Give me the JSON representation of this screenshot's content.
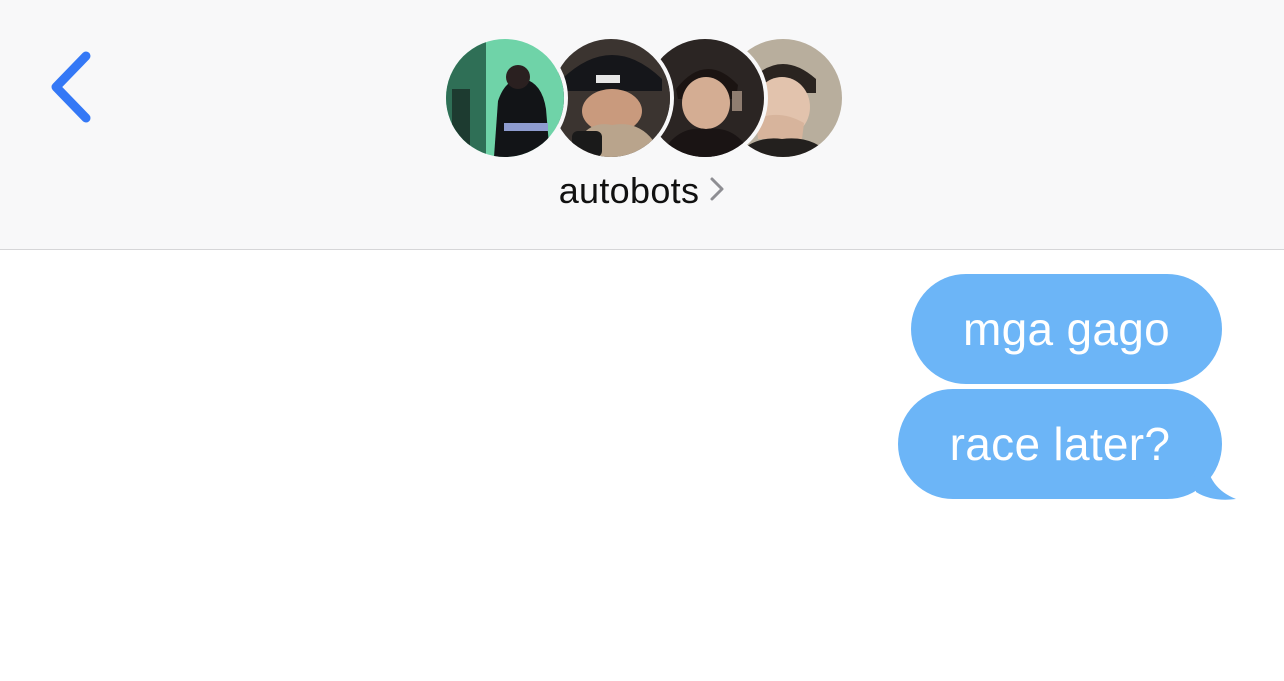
{
  "header": {
    "group_name": "autobots",
    "back_icon": "chevron-left-icon",
    "detail_icon": "chevron-right-icon",
    "avatars": [
      {
        "name": "avatar-member-1",
        "bg": "#6fd3a8"
      },
      {
        "name": "avatar-member-2",
        "bg": "#3b3430"
      },
      {
        "name": "avatar-member-3",
        "bg": "#2b2523"
      },
      {
        "name": "avatar-member-4",
        "bg": "#5e5246"
      }
    ]
  },
  "messages": [
    {
      "text": "mga gago",
      "sender": "me"
    },
    {
      "text": "race later?",
      "sender": "me"
    }
  ],
  "colors": {
    "accent": "#3478f6",
    "bubble": "#6cb5f7",
    "header_bg": "#f8f8f9"
  }
}
